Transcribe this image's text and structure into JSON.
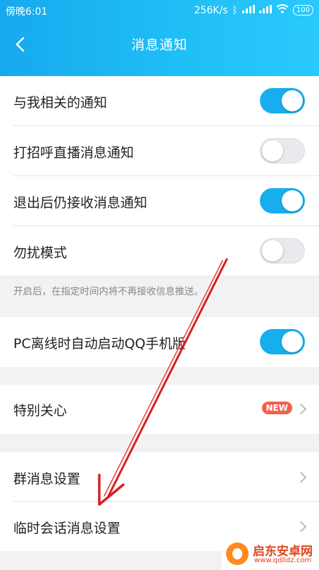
{
  "status": {
    "time": "傍晚6:01",
    "speed": "256K/s",
    "battery": "100"
  },
  "nav": {
    "title": "消息通知"
  },
  "rows": {
    "related": {
      "label": "与我相关的通知",
      "on": true
    },
    "greet": {
      "label": "打招呼直播消息通知",
      "on": false
    },
    "exit": {
      "label": "退出后仍接收消息通知",
      "on": true
    },
    "dnd": {
      "label": "勿扰模式",
      "on": false
    },
    "pc": {
      "label": "PC离线时自动启动QQ手机版",
      "on": true
    },
    "special": {
      "label": "特别关心",
      "badge": "NEW"
    },
    "group": {
      "label": "群消息设置"
    },
    "temp": {
      "label": "临时会话消息设置"
    }
  },
  "hint": "开启后，在指定时间内将不再接收信息推送。",
  "watermark": {
    "title": "启东安卓网",
    "url": "www.qdlldz.com"
  },
  "colors": {
    "accent": "#17aef0",
    "header": "#1fbef6",
    "badge": "#f0614d",
    "annotation_arrow": "#d62020"
  }
}
